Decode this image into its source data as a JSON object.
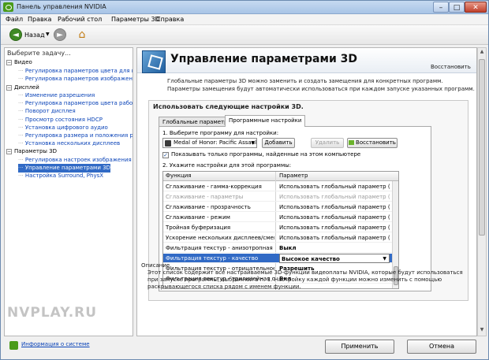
{
  "window": {
    "title": "Панель управления NVIDIA",
    "min": "–",
    "max": "□",
    "close": "✕"
  },
  "menu": [
    "Файл",
    "Правка",
    "Рабочий стол",
    "Параметры 3D",
    "Справка"
  ],
  "toolbar": {
    "back_label": "Назад",
    "back_glyph": "◄",
    "fwd_glyph": "►",
    "dropdown_glyph": "▼",
    "home_glyph": "⌂"
  },
  "sidebar": {
    "header": "Выберите задачу...",
    "toggle_glyph": "−",
    "tree": [
      {
        "type": "category",
        "label": "Видео"
      },
      {
        "type": "link",
        "label": "Регулировка параметров цвета для видео"
      },
      {
        "type": "link",
        "label": "Регулировка параметров изображения для видео"
      },
      {
        "type": "category",
        "label": "Дисплей"
      },
      {
        "type": "link",
        "label": "Изменение разрешения"
      },
      {
        "type": "link",
        "label": "Регулировка параметров цвета рабочего стола"
      },
      {
        "type": "link",
        "label": "Поворот дисплея"
      },
      {
        "type": "link",
        "label": "Просмотр состояния HDCP"
      },
      {
        "type": "link",
        "label": "Установка цифрового аудио"
      },
      {
        "type": "link",
        "label": "Регулировка размера и положения рабочего стола"
      },
      {
        "type": "link",
        "label": "Установка нескольких дисплеев"
      },
      {
        "type": "category",
        "label": "Параметры 3D"
      },
      {
        "type": "link",
        "label": "Регулировка настроек изображения с просмотром"
      },
      {
        "type": "link",
        "label": "Управление параметрами 3D",
        "selected": true
      },
      {
        "type": "link",
        "label": "Настройка Surround, PhysX"
      }
    ],
    "sysinfo": "Информация о системе"
  },
  "main": {
    "title": "Управление параметрами 3D",
    "restore": "Восстановить",
    "intro": "Глобальные параметры 3D можно заменить и создать замещения для конкретных программ. Параметры замещения будут автоматически использоваться при каждом запуске указанных программ.",
    "section_label": "Использовать следующие настройки 3D.",
    "tabs": [
      "Глобальные параметры",
      "Программные настройки"
    ],
    "step1": "1. Выберите программу для настройки:",
    "program": "Medal of Honor: Pacific Assault ...",
    "buttons": {
      "add": "Добавить",
      "remove": "Удалить",
      "restore": "Восстановить"
    },
    "checkbox_mark": "✓",
    "checkbox_label": "Показывать только программы, найденные на этом компьютере",
    "step2": "2. Укажите настройки для этой программы:",
    "grid": {
      "headers": [
        "Функция",
        "Параметр"
      ],
      "rows": [
        {
          "func": "Сглаживание - гамма-коррекция",
          "param": "Использовать глобальный параметр (Вкл)",
          "state": "normal"
        },
        {
          "func": "Сглаживание - параметры",
          "param": "Использовать глобальный параметр (У...",
          "state": "dim"
        },
        {
          "func": "Сглаживание - прозрачность",
          "param": "Использовать глобальный параметр (В...",
          "state": "normal"
        },
        {
          "func": "Сглаживание - режим",
          "param": "Использовать глобальный параметр (У...",
          "state": "normal"
        },
        {
          "func": "Тройная буферизация",
          "param": "Использовать глобальный параметр (В...",
          "state": "normal"
        },
        {
          "func": "Ускорение нескольких дисплеев/смеша...",
          "param": "Использовать глобальный параметр (Р...",
          "state": "normal"
        },
        {
          "func": "Фильтрация текстур - анизотропная оп...",
          "param": "Выкл",
          "state": "bold"
        },
        {
          "func": "Фильтрация текстур - качество",
          "param": "Высокое качество",
          "state": "selected"
        },
        {
          "func": "Фильтрация текстур - отрицательное о...",
          "param": "Разрешить",
          "state": "bold"
        },
        {
          "func": "Фильтрация текстур - трилинейная опт...",
          "param": "Вкл",
          "state": "bold"
        }
      ]
    },
    "description_title": "Описание.",
    "description": "Этот список содержит все настраиваемые 3D-функции видеоплаты NVIDIA, которые будут использоваться при запуске программы, выбранной в п. 1. Настройку каждой функции можно изменить с помощью раскрывающегося списка рядом с именем функции."
  },
  "footer": {
    "apply": "Применить",
    "cancel": "Отмена"
  },
  "watermark": "NVPLAY.RU",
  "colors": {
    "accent": "#316ac5",
    "nvidia_green": "#4a9b1a",
    "link": "#0b44b8"
  }
}
